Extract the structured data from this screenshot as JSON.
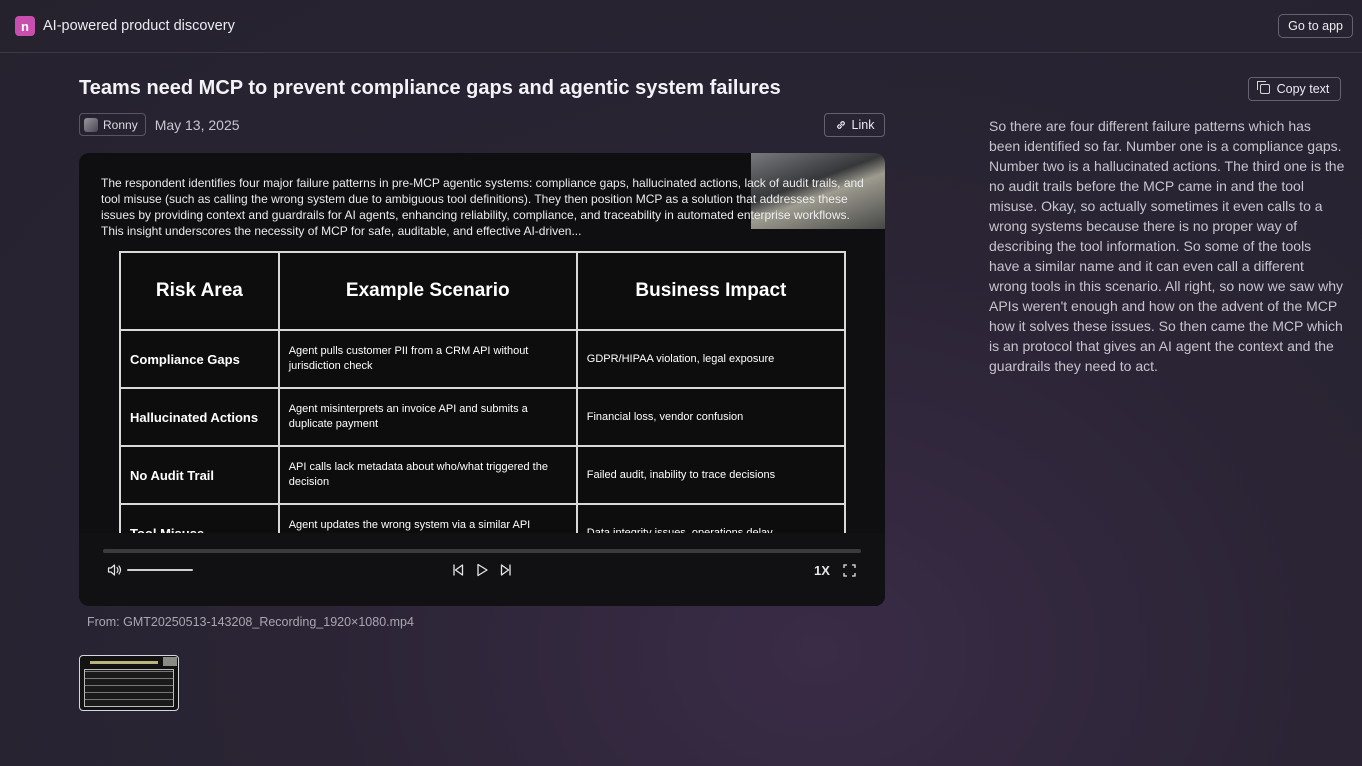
{
  "header": {
    "app_title": "AI-powered product discovery",
    "logo_letter": "n",
    "go_to_app": "Go to app"
  },
  "insight": {
    "title": "Teams need MCP to prevent compliance gaps and agentic system failures",
    "author": "Ronny",
    "date": "May 13, 2025",
    "link_label": "Link",
    "copy_label": "Copy text",
    "summary": "The respondent identifies four major failure patterns in pre-MCP agentic systems: compliance gaps, hallucinated actions, lack of audit trails, and tool misuse (such as calling the wrong system due to ambiguous tool definitions). They then position MCP as a solution that addresses these issues by providing context and guardrails for AI agents, enhancing reliability, compliance, and traceability in automated enterprise workflows. This insight underscores the necessity of MCP for safe, auditable, and effective AI-driven...",
    "transcript": "So there are four different failure patterns which has been identified so far. Number one is a compliance gaps. Number two is a hallucinated actions. The third one is the no audit trails before the MCP came in and the tool misuse. Okay, so actually sometimes it even calls to a wrong systems because there is no proper way of describing the tool information. So some of the tools have a similar name and it can even call a different wrong tools in this scenario. All right, so now we saw why APIs weren't enough and how on the advent of the MCP how it solves these issues. So then came the MCP which is an protocol that gives an AI agent the context and the guardrails they need to act.",
    "source": "From: GMT20250513-143208_Recording_1920×1080.mp4"
  },
  "video_table": {
    "headers": [
      "Risk Area",
      "Example Scenario",
      "Business Impact"
    ],
    "rows": [
      [
        "Compliance Gaps",
        "Agent pulls customer PII from a CRM API without jurisdiction check",
        "GDPR/HIPAA violation, legal exposure"
      ],
      [
        "Hallucinated Actions",
        "Agent misinterprets an invoice API and submits a duplicate payment",
        "Financial loss, vendor confusion"
      ],
      [
        "No Audit Trail",
        "API calls lack metadata about who/what triggered the decision",
        "Failed audit, inability to trace decisions"
      ],
      [
        "Tool Misuse",
        "Agent updates the wrong system via a similar API endpoint",
        "Data integrity issues, operations delay"
      ]
    ]
  },
  "player": {
    "speed": "1X",
    "progress": 0.0,
    "volume": 0.55,
    "icons": [
      "volume-icon",
      "skip-back-icon",
      "play-icon",
      "skip-forward-icon",
      "fullscreen-icon"
    ]
  },
  "colors": {
    "brand": "#c94fae",
    "background": "#27232f"
  }
}
